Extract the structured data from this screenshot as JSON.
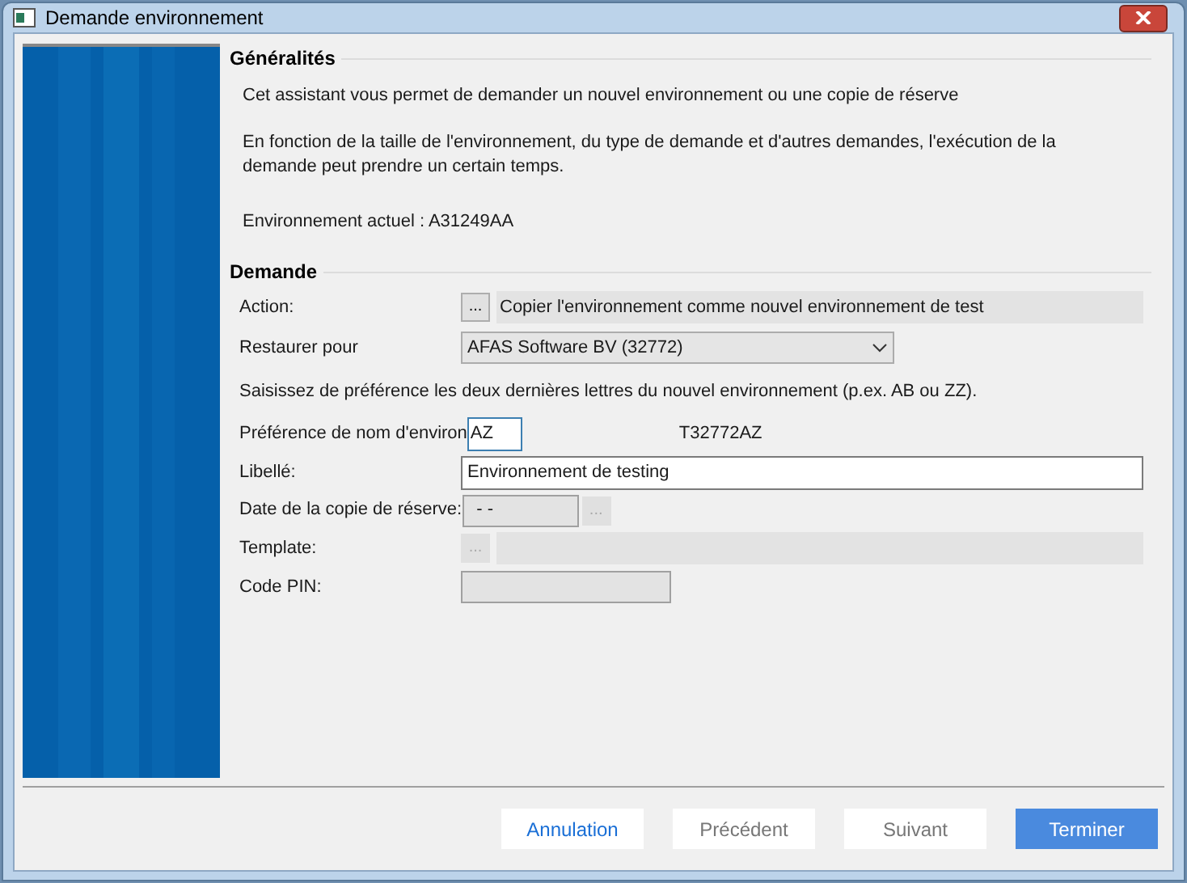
{
  "window": {
    "title": "Demande environnement"
  },
  "general": {
    "title": "Généralités",
    "paragraphs": [
      "Cet assistant vous permet de demander un nouvel environnement ou une copie de réserve",
      "En fonction de la taille de l'environnement, du type de demande et d'autres demandes, l'exécution de la demande peut prendre un certain temps."
    ],
    "current": "Environnement actuel : A31249AA"
  },
  "request": {
    "title": "Demande",
    "rows": [
      {
        "kind": "picker",
        "label": "Action:",
        "button": "...",
        "value": "Copier l'environnement comme nouvel environnement de test",
        "disabled": false
      },
      {
        "kind": "select",
        "label": "Restaurer pour",
        "value": "AFAS Software BV (32772)"
      },
      {
        "kind": "hint",
        "label": "Saisissez de préférence les deux dernières lettres du nouvel environnement (p.ex. AB ou ZZ)."
      },
      {
        "kind": "short",
        "label": "Préférence de nom d'environ",
        "value": "AZ",
        "focused": true,
        "note": "T32772AZ"
      },
      {
        "kind": "input",
        "label": "Libellé:",
        "value": "Environnement de testing"
      },
      {
        "kind": "date",
        "label": "Date de la copie de réserve:",
        "value": "- -",
        "button": "...",
        "disabled": true
      },
      {
        "kind": "picker",
        "label": "Template:",
        "button": "...",
        "disabled": true
      },
      {
        "kind": "pin",
        "label": "Code PIN:",
        "disabled": true
      }
    ]
  },
  "buttons": [
    {
      "label": "Annulation",
      "kind": "link",
      "disabled": false
    },
    {
      "label": "Précédent",
      "kind": "normal",
      "disabled": true
    },
    {
      "label": "Suivant",
      "kind": "normal",
      "disabled": true
    },
    {
      "label": "Terminer",
      "kind": "primary",
      "disabled": false
    }
  ]
}
